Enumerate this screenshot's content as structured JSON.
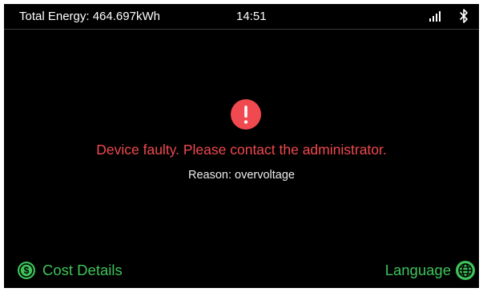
{
  "status_bar": {
    "total_energy_label": "Total Energy:",
    "total_energy_value": "464.697kWh",
    "time": "14:51",
    "signal_icon": "signal-strength-icon",
    "bluetooth_icon": "bluetooth-icon"
  },
  "alert": {
    "icon": "exclamation-icon",
    "message": "Device faulty. Please contact the administrator.",
    "reason_label": "Reason:",
    "reason_value": "overvoltage"
  },
  "footer": {
    "cost_details_label": "Cost Details",
    "cost_icon": "dollar-circle-icon",
    "language_label": "Language",
    "language_icon": "globe-icon"
  },
  "colors": {
    "background": "#000000",
    "error": "#f0494f",
    "accent": "#3ec25a",
    "text": "#ffffff"
  }
}
